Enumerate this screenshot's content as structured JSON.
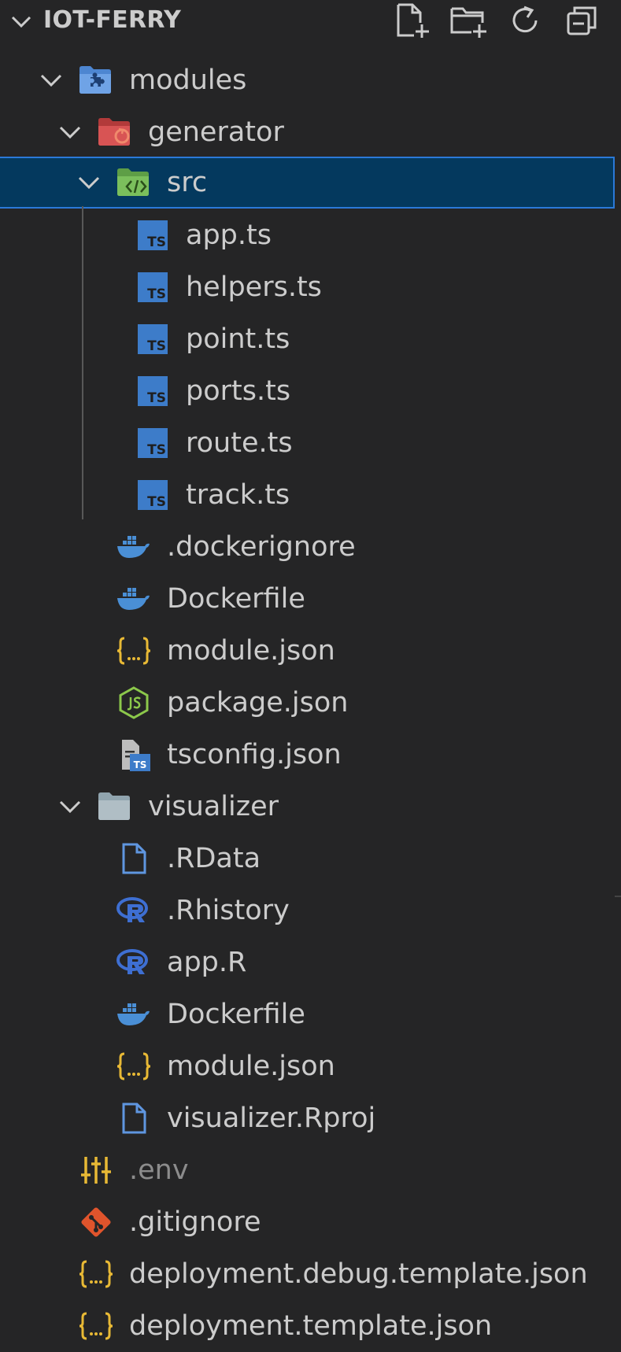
{
  "explorer": {
    "title": "IOT-FERRY",
    "toolbar": {
      "new_file": "new-file-icon",
      "new_folder": "new-folder-icon",
      "refresh": "refresh-icon",
      "collapse": "collapse-all-icon"
    },
    "items": [
      {
        "label": "modules",
        "type": "folder",
        "icon": "modules-folder-icon",
        "expanded": true
      },
      {
        "label": "generator",
        "type": "folder",
        "icon": "generator-folder-icon",
        "expanded": true
      },
      {
        "label": "src",
        "type": "folder",
        "icon": "src-folder-icon",
        "expanded": true,
        "selected": true
      },
      {
        "label": "app.ts",
        "type": "file",
        "icon": "typescript-icon"
      },
      {
        "label": "helpers.ts",
        "type": "file",
        "icon": "typescript-icon"
      },
      {
        "label": "point.ts",
        "type": "file",
        "icon": "typescript-icon"
      },
      {
        "label": "ports.ts",
        "type": "file",
        "icon": "typescript-icon"
      },
      {
        "label": "route.ts",
        "type": "file",
        "icon": "typescript-icon"
      },
      {
        "label": "track.ts",
        "type": "file",
        "icon": "typescript-icon"
      },
      {
        "label": ".dockerignore",
        "type": "file",
        "icon": "docker-icon"
      },
      {
        "label": "Dockerfile",
        "type": "file",
        "icon": "docker-icon"
      },
      {
        "label": "module.json",
        "type": "file",
        "icon": "json-braces-icon"
      },
      {
        "label": "package.json",
        "type": "file",
        "icon": "nodejs-icon"
      },
      {
        "label": "tsconfig.json",
        "type": "file",
        "icon": "tsconfig-icon"
      },
      {
        "label": "visualizer",
        "type": "folder",
        "icon": "folder-icon",
        "expanded": true
      },
      {
        "label": ".RData",
        "type": "file",
        "icon": "file-icon"
      },
      {
        "label": ".Rhistory",
        "type": "file",
        "icon": "r-icon"
      },
      {
        "label": "app.R",
        "type": "file",
        "icon": "r-icon"
      },
      {
        "label": "Dockerfile",
        "type": "file",
        "icon": "docker-icon"
      },
      {
        "label": "module.json",
        "type": "file",
        "icon": "json-braces-icon"
      },
      {
        "label": "visualizer.Rproj",
        "type": "file",
        "icon": "file-icon"
      },
      {
        "label": ".env",
        "type": "file",
        "icon": "env-settings-icon",
        "ignored": true
      },
      {
        "label": ".gitignore",
        "type": "file",
        "icon": "git-icon"
      },
      {
        "label": "deployment.debug.template.json",
        "type": "file",
        "icon": "json-braces-icon"
      },
      {
        "label": "deployment.template.json",
        "type": "file",
        "icon": "json-braces-icon"
      }
    ]
  },
  "colors": {
    "background": "#252526",
    "selection": "#04395e",
    "selection_border": "#2b79d8",
    "text": "#cccccc",
    "typescript": "#3d7cc9",
    "json": "#e8b935",
    "docker": "#4a8fd6",
    "node": "#8cc84b",
    "git": "#e0542c",
    "r": "#3e6fd2"
  }
}
